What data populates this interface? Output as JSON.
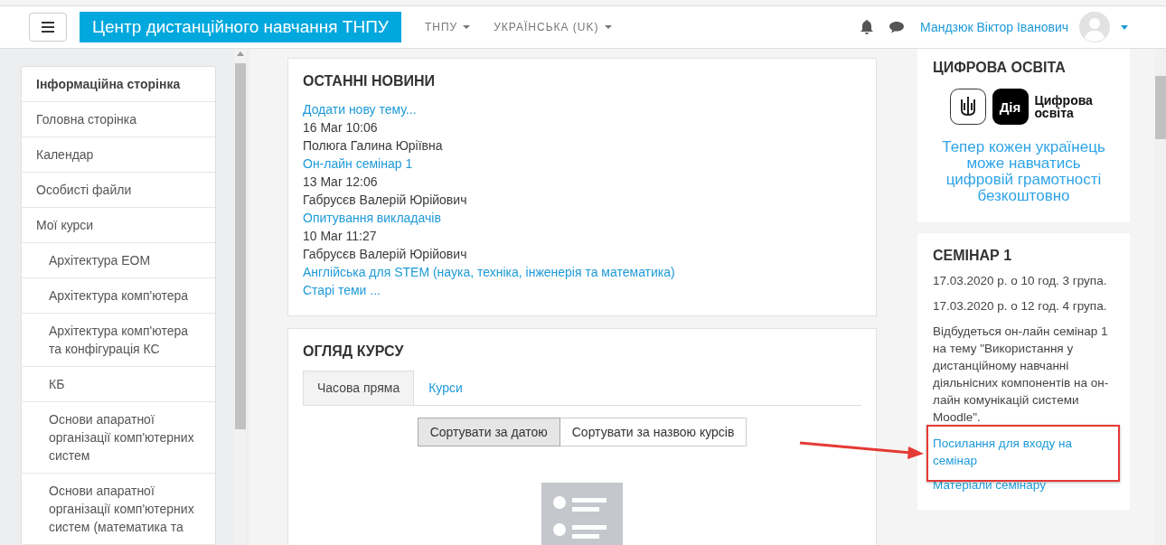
{
  "header": {
    "site_name": "Центр дистанційного навчання ТНПУ",
    "nav_menus": [
      {
        "label": "ТНПУ"
      },
      {
        "label": "УКРАЇНСЬКА (UK)"
      }
    ],
    "user_name": "Мандзюк Віктор Іванович"
  },
  "sidebar": {
    "items": [
      {
        "label": "Інформаційна сторінка",
        "selected": true
      },
      {
        "label": "Головна сторінка",
        "selected": false
      },
      {
        "label": "Календар",
        "selected": false
      },
      {
        "label": "Особисті файли",
        "selected": false
      },
      {
        "label": "Мої курси",
        "selected": false,
        "children": [
          {
            "label": "Архітектура ЕОМ",
            "selected": false
          },
          {
            "label": "Архітектура комп'ютера",
            "selected": false
          },
          {
            "label": "Архітектура комп'ютера та конфігурація КС",
            "selected": false
          },
          {
            "label": "КБ",
            "selected": false
          },
          {
            "label": "Основи апаратної організації комп'ютерних систем",
            "selected": false
          },
          {
            "label": "Основи апаратної організації комп'ютерних систем (математика та",
            "selected": false
          }
        ]
      }
    ]
  },
  "news": {
    "title": "ОСТАННІ НОВИНИ",
    "add_link": "Додати нову тему...",
    "posts": [
      {
        "date": "16 Mar 10:06",
        "author": "Полюга Галина Юріївна",
        "subject": "Он-лайн семінар 1"
      },
      {
        "date": "13 Mar 12:06",
        "author": "Габрусєв Валерій Юрійович",
        "subject": "Опитування викладачів"
      },
      {
        "date": "10 Mar 11:27",
        "author": "Габрусєв Валерій Юрійович",
        "subject": "Англійська для STEM (наука, техніка, інженерія та математика)"
      }
    ],
    "older_link": "Старі теми ..."
  },
  "course_overview": {
    "title": "ОГЛЯД КУРСУ",
    "tabs": [
      {
        "label": "Часова пряма",
        "selected": true
      },
      {
        "label": "Курси",
        "selected": false
      }
    ],
    "sort_buttons": [
      {
        "label": "Сортувати за датою",
        "selected": true
      },
      {
        "label": "Сортувати за назвою курсів",
        "selected": false
      }
    ]
  },
  "digital_block": {
    "title": "ЦИФРОВА ОСВІТА",
    "logo_mark": "Дія",
    "logo_text": "Цифрова освіта",
    "promo": "Тепер кожен українець може навчатись цифровій грамотності безкоштовно"
  },
  "seminar_block": {
    "title": "СЕМІНАР 1",
    "paragraphs": [
      "17.03.2020 р. о 10 год. 3 група.",
      "17.03.2020 р. о 12 год. 4 група.",
      "Відбудеться он-лайн  семінар 1 на тему  \"Використання у дистанційному навчанні діяльнісних компонентів на он-лайн комунікацій системи Moodle\"."
    ],
    "links": [
      "Посилання для входу на семінар",
      "Матеріали семінару"
    ]
  }
}
